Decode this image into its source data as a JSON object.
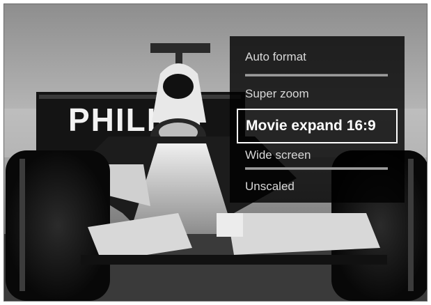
{
  "screen": {
    "background_description_icon": "f1-racecar-photo",
    "livery_text": "PHILIPS"
  },
  "format_menu": {
    "items": [
      {
        "label": "Auto format",
        "selected": false
      },
      {
        "label": "Super zoom",
        "selected": false
      },
      {
        "label": "Movie expand 16:9",
        "selected": true
      },
      {
        "label": "Wide screen",
        "selected": false
      },
      {
        "label": "Unscaled",
        "selected": false
      }
    ]
  },
  "colors": {
    "menu_bg": "#000000",
    "selection_border": "#ffffff",
    "menu_text": "#d8d8d8"
  }
}
